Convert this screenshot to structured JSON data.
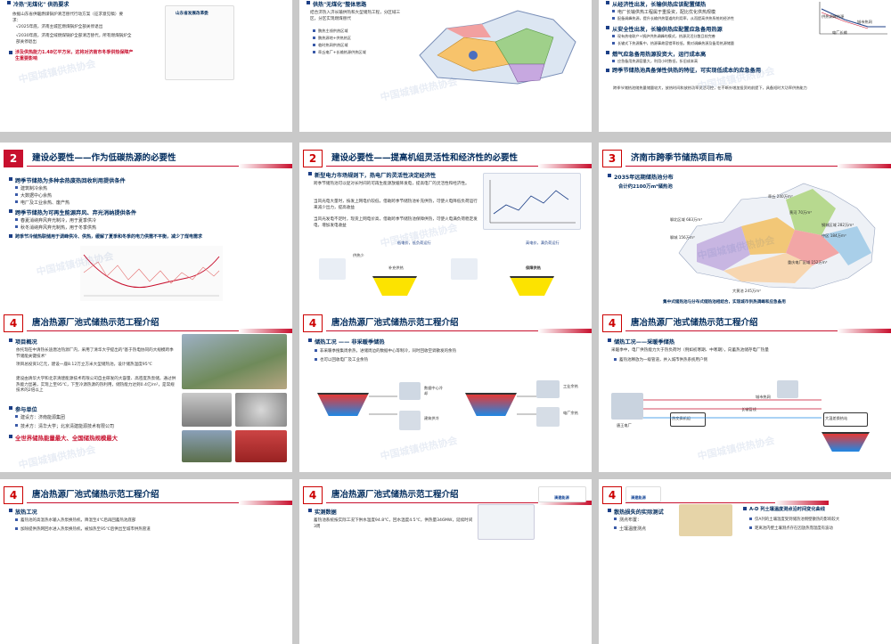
{
  "row0": {
    "left": {
      "title": "冷热\"无煤化\" 供热要求",
      "lines": [
        "依据山东省供暖燃煤锅炉清洁替代行动方案（征求意见稿）要求：",
        "√2025年底，济南主城区燃煤锅炉全部关停退出",
        "√2030年底，济南全域燃煤锅炉全部清洁替代，所有燃煤锅炉全部关停退出",
        "涉及供热能力1.48亿平方米，这将对济南市冬季供热保障产生重要影响"
      ],
      "doc_caption": "山东省发展改革委"
    },
    "mid": {
      "title": "供热\"无煤化\"整体思路",
      "lines": [
        "结合济热入济长输供热和大型储热工程，分区域三区，分区实现燃煤替代",
        "鹏热主线供热区域",
        "鹏热源地+供热热区",
        "临时热网供热区域",
        "章丘电厂+长输热源供热区域"
      ]
    },
    "right": {
      "lines": [
        "从经济性出发，长输供热应该配置储热",
        "电厂长输供热工程属于重投资，配比优化供热规模",
        "配备调峰热源，提升长输供热管道的利用率，从而提高供热系统的经济性",
        "从安全性出发，长输供热应配置应急备用热源",
        "现有热电联产+锅炉供热调峰的模式，热源灵活分散且较完善",
        "长输式下热源集中，热源事故容错率较低，需对调峰热源及备用热源储量",
        "燃气应急备用热源投资大，运行成本高",
        "应急备用热源容量大，利用小时数低，折旧成本高",
        "跨季节储热池具备弹性供热的特征，可实现低成本的应急备用",
        "跨季节储热池储热量储量较大，放热时间和放热功率灵活可控，在不断外增加投资的前提下，具备短时大功率供热能力"
      ],
      "chart_labels": [
        "供热调峰热源",
        "城市热网",
        "电厂长输"
      ]
    }
  },
  "s1": {
    "num": "2",
    "title": "建设必要性——作为低碳热源的必要性",
    "items": [
      "跨季节储热为多种余热废热回收利用提供条件",
      "建筑制冷余热",
      "大数据中心余热",
      "电厂及工业余热、废产热",
      "跨季节储热为可再生能源弃风、弃光消纳提供条件",
      "春夏消纳弃风弃光制冷，用于夏季供冷",
      "秋冬消纳弃风弃光制热，用于冬季供热",
      "跨季节冷储热联储用于调峰供冷、供热，缓解了夏季和冬季的电力供需不平衡，减少了煤电需求"
    ]
  },
  "s2": {
    "num": "2",
    "title": "建设必要性——提高机组灵活性和经济性的必要性",
    "items": [
      "新型电力市场规则下，热电厂的灵活性决定经济性",
      "跨季节储热池可以促对长时间的可再生能源放缓降发电，提高电厂的灵活性和经济性。",
      "当风光电大量时，按发上网电价较低，借助跨季节储热池补充供热，可使火电降低负荷运行来减少出力，提高收益",
      "当风光发电不足时，现货上网电价高，借助跨季节储热池保障供热，可使火电满负荷稳定发电，增加发电收益"
    ],
    "diagram": {
      "high": "高电价，满负荷运行",
      "low": "低电价，低负荷运行",
      "supply": "保障供热",
      "aux": "补充供热",
      "more": "供热少"
    }
  },
  "s3": {
    "num": "3",
    "title": "济南市跨季节储热项目布局",
    "items": [
      "2035年远期储热池分布",
      "合计约2100万m³储热池"
    ],
    "labels": [
      "章丘 240万m³",
      "聊北区域 683万m³",
      "黄河 70万m³",
      "钢城区域 282万m³",
      "中区 184万m³",
      "聊城 156万m³",
      "大黄池 245万m³",
      "重庆电厂区域 152万m³"
    ],
    "caption": "集中式储热池与分布式储热池相结合，实现城市供热调峰和应急备用"
  },
  "s4": {
    "num": "4",
    "title": "唐冶热源厂池式储热示范工程介绍",
    "items": [
      "项目概况",
      "依托现在中清热长途唐冶热源厂内，采用了清华大学提出的\"基于热电协同的大规模跨季节储能关键技术\"",
      "项目总投资1亿元，建设一座8.12万立方米大型储热池，设计储热温度95℃",
      "建设由清华大学和北京清建能源技术有限公司自主研发的大容量、高密度热泵储，通过供热能力显著，实现上至95℃，下至冷源热源的热利用，储热能力达到0.4亿/m²，是常规技术的2倍以上",
      "参与单位",
      "建设方：济南能源集团",
      "技术方：清华大学；北京清建能源技术有限公司",
      "全世界储热能量最大、全国储热规模最大"
    ]
  },
  "s5": {
    "num": "4",
    "title": "唐冶热源厂池式储热示范工程介绍",
    "items": [
      "储热工况 —— 非采暖季储热",
      "非采暖季搜集周余热，进储周边的数据中心等制冷，同时回收空调散发的余热",
      "也可以回收电厂及工业余热"
    ],
    "labels": [
      "数据中心冷却",
      "建筑供冷",
      "工业余热",
      "电厂余热"
    ]
  },
  "s6": {
    "num": "4",
    "title": "唐冶热源厂池式储热示范工程介绍",
    "items": [
      "储热工况——采暖季储热",
      "采暖季中，电厂供热能力大于热负荷时（例如初寒期、中寒期），向蓄热池储存电厂热量",
      "蓄热池释放为一级管道，并入城市供热系统用户侧"
    ],
    "labels": [
      "唐王电厂",
      "城市热网",
      "长输管线",
      "热交换机组",
      "大温差换热站"
    ]
  },
  "s7": {
    "num": "4",
    "title": "唐冶热源厂池式储热示范工程介绍",
    "items": [
      "放热工况",
      "蓄热池的高温热水输入热泵换热机，降温至4℃后再回蓄热池底部",
      "加除提供热网回水进入热泵换热机，被加热至95℃后供出至城市供热管道"
    ]
  },
  "s8": {
    "num": "4",
    "title": "唐冶热源厂池式储热示范工程介绍",
    "items": [
      "实测数据",
      "蓄热池系统按实际工况下供水温度94.8℃，回水温度4.5℃，供热量346MW，延续时间3周"
    ],
    "logo": "清建能源"
  },
  "s9": {
    "num": "4",
    "items": [
      "散热损失的实际测试",
      "测点布置：",
      "土壤温度测点",
      "A-D 列土壤温度测点沿时间变化曲线",
      "仅A列的土壤温度受到储热池侧壁散热的影响较大",
      "距离池内壁土壤测点存在因放热而温度有波动"
    ],
    "logo": "清建能源"
  },
  "watermark": "中国城镇供热协会",
  "colors": {
    "accent": "#c8102e",
    "navy": "#002b5c",
    "bullet": "#1c3f87",
    "tank": "#fce300"
  }
}
